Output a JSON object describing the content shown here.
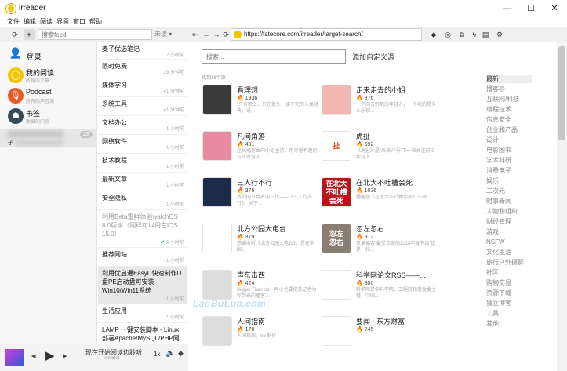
{
  "window": {
    "title": "irreader",
    "minimize": "—",
    "maximize": "☐",
    "close": "✕"
  },
  "menu": [
    "文件",
    "编辑",
    "阅读",
    "界面",
    "窗口",
    "帮助"
  ],
  "toolbar": {
    "feed_search_placeholder": "搜索feed",
    "filter_value": "未读",
    "url": "https://fatecore.com/irreader/target-search/"
  },
  "sidebar": {
    "login": "登录",
    "my_reading": {
      "title": "我的阅读",
      "sub": "所有的文章"
    },
    "podcast": {
      "title": "Podcast",
      "sub": "所有的声音源"
    },
    "bookmarks": {
      "title": "书签",
      "sub": "收藏的内容"
    },
    "feed_badge": "29",
    "feed_sub": "子"
  },
  "articles": [
    {
      "title": "麦子优选笔记",
      "time": "2 小时前",
      "read": false
    },
    {
      "title": "限时免费",
      "time": "29 分钟前",
      "read": false
    },
    {
      "title": "媒体学习",
      "time": "41 分钟前",
      "read": false
    },
    {
      "title": "系统工具",
      "time": "41 分钟前",
      "read": false
    },
    {
      "title": "文档办公",
      "time": "1 小时前",
      "read": false
    },
    {
      "title": "网络软件",
      "time": "1 小时前",
      "read": false
    },
    {
      "title": "技术教程",
      "time": "1 小时前",
      "read": false
    },
    {
      "title": "最新文章",
      "time": "1 小时前",
      "read": false
    },
    {
      "title": "安全隐私",
      "time": "1 小时前",
      "read": false
    },
    {
      "title": "利用Beta雷鲜体验watchOS 8.0版本（同样可以用在iOS 15.0）",
      "time": "2 小时前",
      "read": true
    },
    {
      "title": "推荐网站",
      "time": "1 小时前",
      "read": false
    },
    {
      "title": "利用优启通EasyU快速制作U盘PE启动盘可安装Win10/Win11系统",
      "time": "1 小时前",
      "read": false
    },
    {
      "title": "生活应用",
      "time": "1 小时前",
      "read": false
    },
    {
      "title": "LAMP 一键安装脚本 - Linux部署Apache/MySQL/PHP网站运行环境",
      "time": "",
      "read": false
    }
  ],
  "content": {
    "search_placeholder": "搜索...",
    "custom_source": "添加自定义源",
    "result_count": "找到18个源",
    "sources": [
      {
        "name": "看理想",
        "stat": "🔥 1936",
        "desc": "“只有晚上，只在街头；读不完的人类经典，说...",
        "thumb": "#3a3a3a",
        "glyph": ""
      },
      {
        "name": "走来走去的小姐",
        "stat": "🔥 876",
        "desc": "一个闲云野鹤的年轻人，一个宅的是多么乐观...",
        "thumb": "#f2b9b3",
        "glyph": ""
      },
      {
        "name": "凡间角落",
        "stat": "🔥 431",
        "desc": "这档播客由FJ小组主持，用尽量有趣的方式说说人...",
        "thumb": "#e88aa0",
        "glyph": ""
      },
      {
        "name": "虎扯",
        "stat": "🔥 692",
        "desc": "《虎扯》是“后来77号”下一档关注前沿年轻人...",
        "thumb": "#ffffff",
        "glyph": "扯"
      },
      {
        "name": "三人行不行",
        "stat": "🔥 375",
        "desc": "我们的节目名叫三代——《三人行不行》。关于...",
        "thumb": "#1c2b4a",
        "glyph": ""
      },
      {
        "name": "在北大不吐槽会死",
        "stat": "🔥 1036",
        "desc": "播客版《在北大不吐槽会死》一档...",
        "thumb": "#b5161b",
        "glyph": "在北大\n不吐槽\n会死"
      },
      {
        "name": "北方公园大电台",
        "stat": "🔥 379",
        "desc": "感谢收听《北方公园大电台》，是在中国...",
        "thumb": "#ffffff",
        "glyph": ""
      },
      {
        "name": "忽左忽右",
        "stat": "🔥 912",
        "desc": "草果播客“最受欢迎的2018年度节目”这是一档...",
        "thumb": "#8a7e72",
        "glyph": "忽左\n忽右"
      },
      {
        "name": "声东击西",
        "stat": "🔥 424",
        "desc": "Bigger Than Us，再小也要把美记者为你带来的播客...",
        "thumb": "#dddddd",
        "glyph": ""
      },
      {
        "name": "科学网论文RSS——...",
        "stat": "🔥 800",
        "desc": "科学网是中科学院、工程院和基金委主管、中国...",
        "thumb": "#ffffff",
        "glyph": ""
      },
      {
        "name": "人间指南",
        "stat": "🔥 170",
        "desc": "人间指南。hb 制作",
        "thumb": "#dddddd",
        "glyph": ""
      },
      {
        "name": "要闻 - 东方财富",
        "stat": "🔥 245",
        "desc": "",
        "thumb": "#ffffff",
        "glyph": ""
      }
    ],
    "categories": [
      "最新",
      "播客@",
      "互联网/科技",
      "编程技术",
      "信息安全",
      "创业和产品",
      "设计",
      "电影图书",
      "学术科研",
      "消费电子",
      "娱乐",
      "二次元",
      "时事新闻",
      "人物和组织",
      "财经管理",
      "游戏",
      "NSFW",
      "文化生活",
      "旅行户外摄影",
      "社区",
      "购物交易",
      "资源下载",
      "独立博客",
      "工具",
      "其他"
    ]
  },
  "player": {
    "now_playing": "现在开始阅读边聆听",
    "source": "irreader",
    "speed": "1x"
  },
  "watermark": "LaoBuLuo.com",
  "colors": {
    "accent": "#f5c400",
    "podcast": "#e85a2a",
    "selected": "#e8e8e8"
  }
}
